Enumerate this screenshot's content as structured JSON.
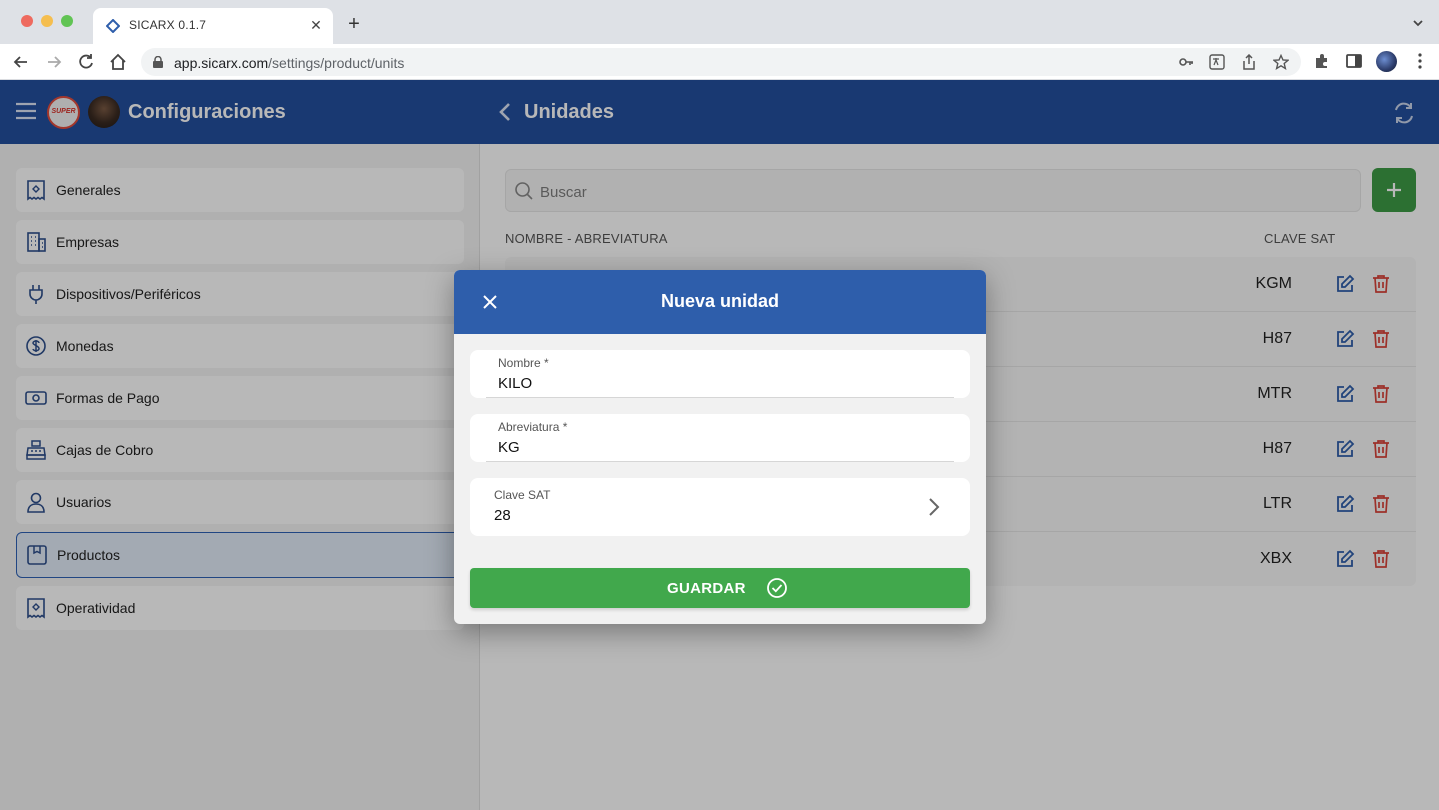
{
  "browser": {
    "tab_title": "SICARX 0.1.7",
    "url_host": "app.sicarx.com",
    "url_path": "/settings/product/units"
  },
  "header": {
    "title": "Configuraciones",
    "page_title": "Unidades",
    "logo_text": "SUPER",
    "color": "#234f9f"
  },
  "sidebar": {
    "items": [
      {
        "label": "Generales",
        "icon": "receipt-icon"
      },
      {
        "label": "Empresas",
        "icon": "building-icon"
      },
      {
        "label": "Dispositivos/Periféricos",
        "icon": "plug-icon"
      },
      {
        "label": "Monedas",
        "icon": "dollar-coin-icon"
      },
      {
        "label": "Formas de Pago",
        "icon": "cash-icon"
      },
      {
        "label": "Cajas de Cobro",
        "icon": "cash-register-icon"
      },
      {
        "label": "Usuarios",
        "icon": "user-icon"
      },
      {
        "label": "Productos",
        "icon": "box-icon",
        "active": true
      },
      {
        "label": "Operatividad",
        "icon": "receipt-icon"
      }
    ]
  },
  "main": {
    "search_placeholder": "Buscar",
    "columns": {
      "name": "NOMBRE - ABREVIATURA",
      "sat": "CLAVE SAT"
    },
    "rows": [
      {
        "clave": "KGM"
      },
      {
        "clave": "H87"
      },
      {
        "clave": "MTR"
      },
      {
        "clave": "H87"
      },
      {
        "clave": "LTR"
      },
      {
        "clave": "XBX"
      }
    ]
  },
  "modal": {
    "title": "Nueva unidad",
    "nombre_label": "Nombre *",
    "nombre_value": "KILO",
    "abreviatura_label": "Abreviatura *",
    "abreviatura_value": "KG",
    "clave_label": "Clave SAT",
    "clave_value": "28",
    "save_label": "GUARDAR",
    "accent": "#2e5eab",
    "save_color": "#41a84c"
  }
}
